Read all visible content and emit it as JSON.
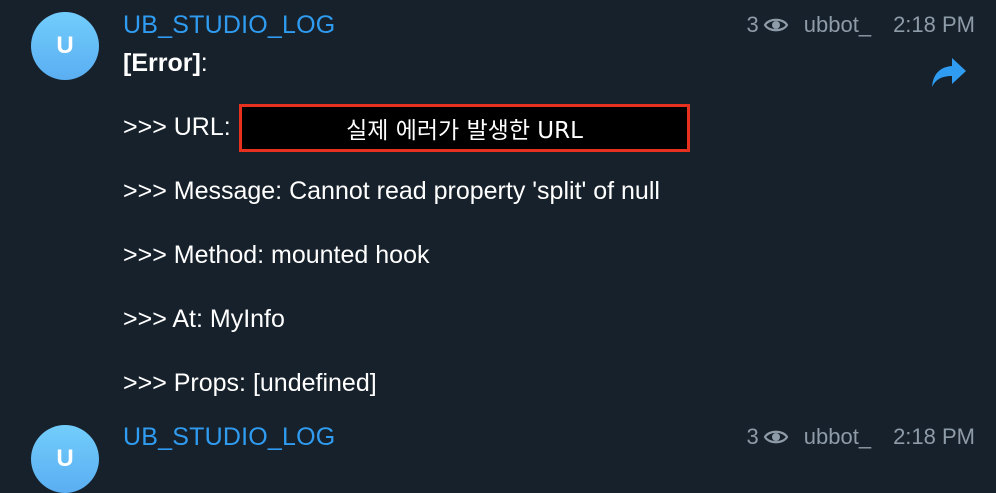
{
  "messages": [
    {
      "avatar_letter": "U",
      "sender": "UB_STUDIO_LOG",
      "views": "3",
      "author": "ubbot_",
      "time": "2:18 PM",
      "error_label": "[Error]",
      "error_colon": ":",
      "url_prefix": ">>> URL:",
      "url_redacted": "실제 에러가 발생한 URL",
      "message_line": ">>> Message: Cannot read property 'split' of null",
      "method_line": ">>> Method: mounted hook",
      "at_line": ">>> At: MyInfo",
      "props_line": ">>> Props: [undefined]"
    },
    {
      "avatar_letter": "U",
      "sender": "UB_STUDIO_LOG",
      "views": "3",
      "author": "ubbot_",
      "time": "2:18 PM"
    }
  ],
  "icons": {
    "views": "eye-icon",
    "forward": "forward-icon"
  },
  "colors": {
    "background": "#17212b",
    "sender": "#2f9cf1",
    "meta": "#8e9ba8",
    "highlight_border": "#e8301f"
  }
}
